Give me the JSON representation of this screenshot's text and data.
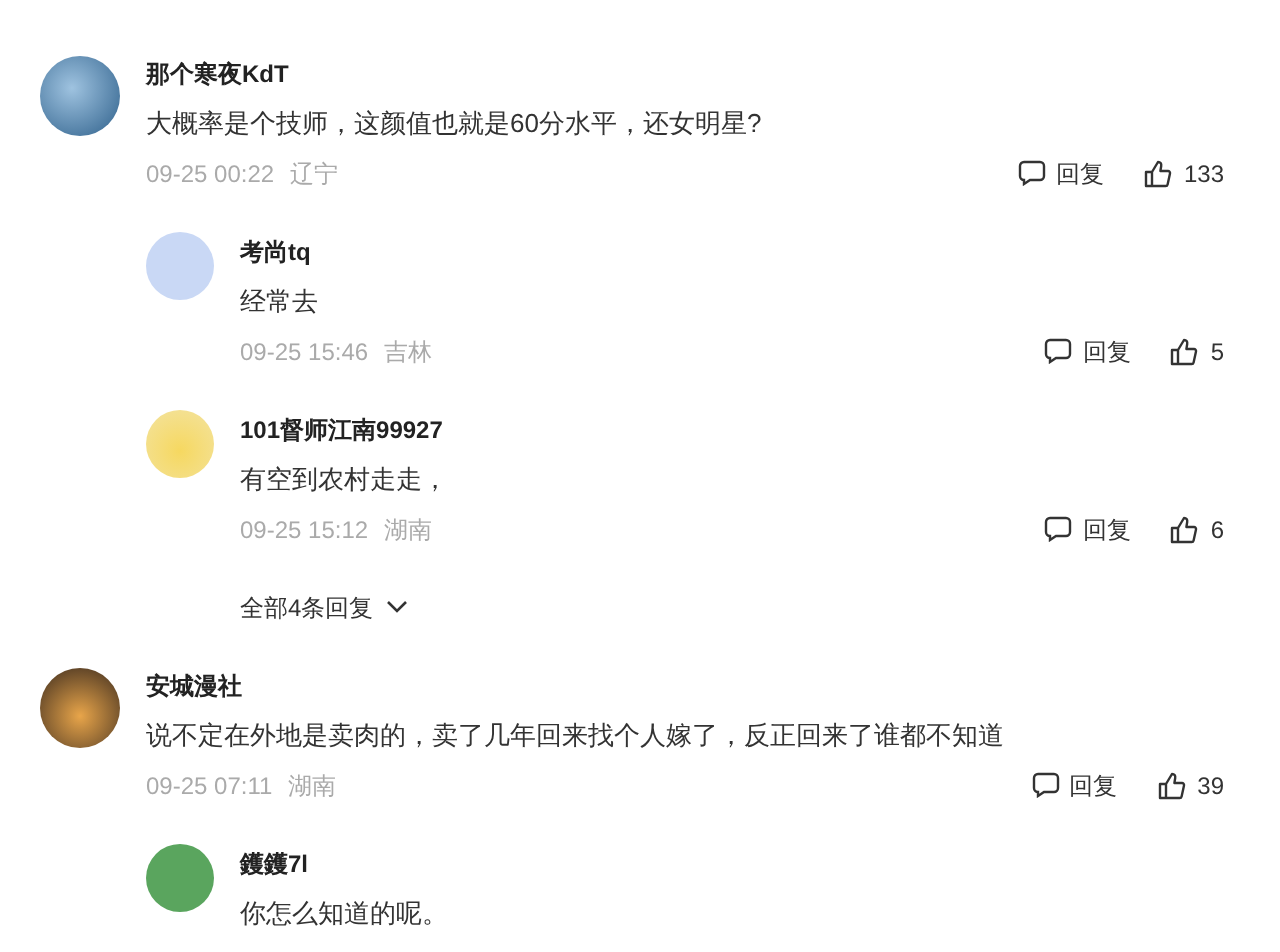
{
  "comments": [
    {
      "user": "那个寒夜KdT",
      "text": "大概率是个技师，这颜值也就是60分水平，还女明星?",
      "time": "09-25 00:22",
      "location": "辽宁",
      "reply_label": "回复",
      "likes": "133",
      "replies": [
        {
          "user": "考尚tq",
          "text": "经常去",
          "time": "09-25 15:46",
          "location": "吉林",
          "reply_label": "回复",
          "likes": "5"
        },
        {
          "user": "101督师江南99927",
          "text": "有空到农村走走，",
          "time": "09-25 15:12",
          "location": "湖南",
          "reply_label": "回复",
          "likes": "6"
        }
      ],
      "more_replies": "全部4条回复"
    },
    {
      "user": "安城漫社",
      "text": "说不定在外地是卖肉的，卖了几年回来找个人嫁了，反正回来了谁都不知道",
      "time": "09-25 07:11",
      "location": "湖南",
      "reply_label": "回复",
      "likes": "39",
      "replies": [
        {
          "user": "鑊鑊7l",
          "text": "你怎么知道的呢。"
        }
      ]
    }
  ]
}
